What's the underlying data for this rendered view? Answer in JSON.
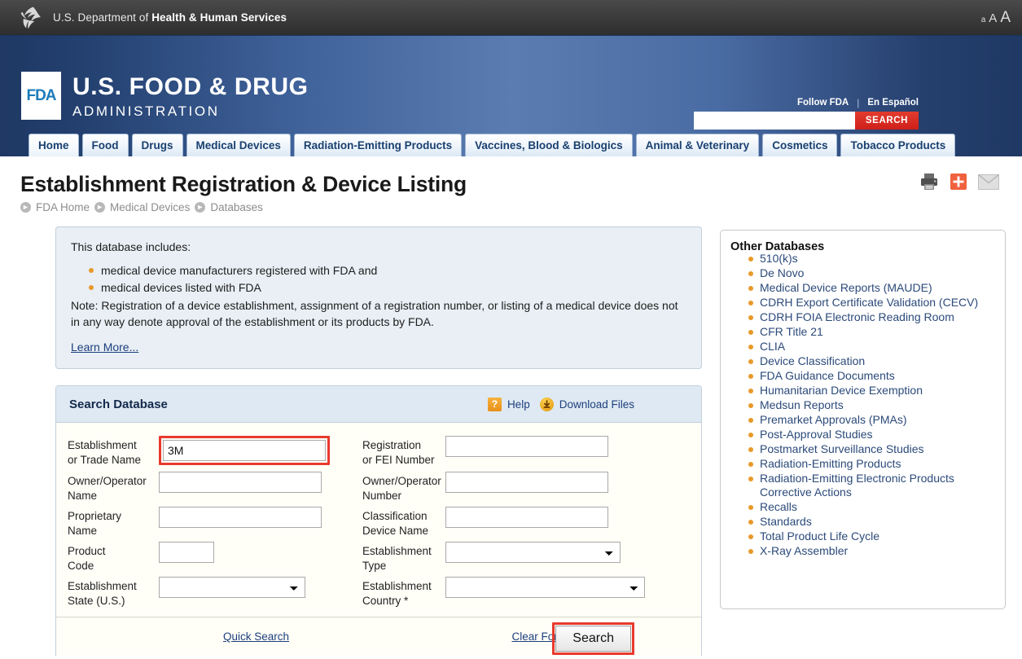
{
  "hhs": {
    "logo_name": "hhs-eagle-logo",
    "text_prefix": "U.S. Department of ",
    "text_bold": "Health & Human Services",
    "font_small": "a",
    "font_medium": "A",
    "font_large": "A"
  },
  "fda": {
    "mark": "FDA",
    "line1": "U.S. FOOD & DRUG",
    "line2": "ADMINISTRATION",
    "follow": "Follow FDA",
    "separator": "|",
    "espanol": "En Español",
    "search_value": "",
    "search_placeholder": "",
    "search_button": "SEARCH"
  },
  "nav": {
    "tabs": [
      {
        "label": "Home",
        "active": true
      },
      {
        "label": "Food",
        "active": false
      },
      {
        "label": "Drugs",
        "active": false
      },
      {
        "label": "Medical Devices",
        "active": false
      },
      {
        "label": "Radiation-Emitting Products",
        "active": false
      },
      {
        "label": "Vaccines, Blood & Biologics",
        "active": false
      },
      {
        "label": "Animal & Veterinary",
        "active": false
      },
      {
        "label": "Cosmetics",
        "active": false
      },
      {
        "label": "Tobacco Products",
        "active": false
      }
    ]
  },
  "page": {
    "title": "Establishment Registration & Device Listing",
    "breadcrumbs": [
      "FDA Home",
      "Medical Devices",
      "Databases"
    ],
    "tool_icons": [
      "print-icon",
      "share-icon",
      "email-icon"
    ]
  },
  "info": {
    "lead": "This database includes:",
    "bullets": [
      "medical device manufacturers registered with FDA and",
      "medical devices listed with FDA"
    ],
    "note": "Note: Registration of a device establishment, assignment of a registration number, or listing of a medical device does not in any way denote approval of the establishment or its products by FDA.",
    "learn_more": "Learn More..."
  },
  "search_panel": {
    "title": "Search Database",
    "help_label": "Help",
    "help_icon": "question-mark-icon",
    "download_label": "Download Files",
    "download_icon": "download-arrow-icon",
    "fields": {
      "establishment_or_trade_name": {
        "label_line1": "Establishment",
        "label_line2": "or Trade Name",
        "value": "3M",
        "highlighted": true
      },
      "registration_or_fei_number": {
        "label_line1": "Registration",
        "label_line2": "or FEI Number",
        "value": ""
      },
      "owner_operator_name": {
        "label_line1": "Owner/Operator",
        "label_line2": "Name",
        "value": ""
      },
      "owner_operator_number": {
        "label_line1": "Owner/Operator",
        "label_line2": "Number",
        "value": ""
      },
      "proprietary_name": {
        "label_line1": "Proprietary",
        "label_line2": "Name",
        "value": ""
      },
      "classification_device_name": {
        "label_line1": "Classification",
        "label_line2": "Device Name",
        "value": ""
      },
      "product_code": {
        "label_line1": "Product",
        "label_line2": "Code",
        "value": ""
      },
      "establishment_type": {
        "label_line1": "Establishment",
        "label_line2": "Type",
        "selected": ""
      },
      "establishment_state": {
        "label_line1": "Establishment",
        "label_line2": "State (U.S.)",
        "selected": ""
      },
      "establishment_country": {
        "label_line1": "Establishment",
        "label_line2": "Country *",
        "selected": ""
      }
    },
    "quick_search": "Quick Search",
    "clear_form": "Clear Form",
    "search_button": "Search",
    "search_button_highlighted": true
  },
  "other_databases": {
    "title": "Other Databases",
    "items": [
      "510(k)s",
      "De Novo",
      "Medical Device Reports (MAUDE)",
      "CDRH Export Certificate Validation (CECV)",
      "CDRH FOIA Electronic Reading Room",
      "CFR Title 21",
      "CLIA",
      "Device Classification",
      "FDA Guidance Documents",
      "Humanitarian Device Exemption",
      "Medsun Reports",
      "Premarket Approvals (PMAs)",
      "Post-Approval Studies",
      "Postmarket Surveillance Studies",
      "Radiation-Emitting Products",
      "Radiation-Emitting Electronic Products Corrective Actions",
      "Recalls",
      "Standards",
      "Total Product Life Cycle",
      "X-Ray Assembler"
    ]
  },
  "colors": {
    "hhs_bar": "#3b3b3b",
    "fda_navy": "#1f3864",
    "fda_mid_blue": "#5a7cb0",
    "search_red": "#cf1f1a",
    "highlight_red": "#e83a2e",
    "link_blue": "#1c3f7c",
    "bullet_orange": "#e8992a",
    "panel_blue": "#e9eff5",
    "panel_header_blue": "#dfe9f3"
  }
}
